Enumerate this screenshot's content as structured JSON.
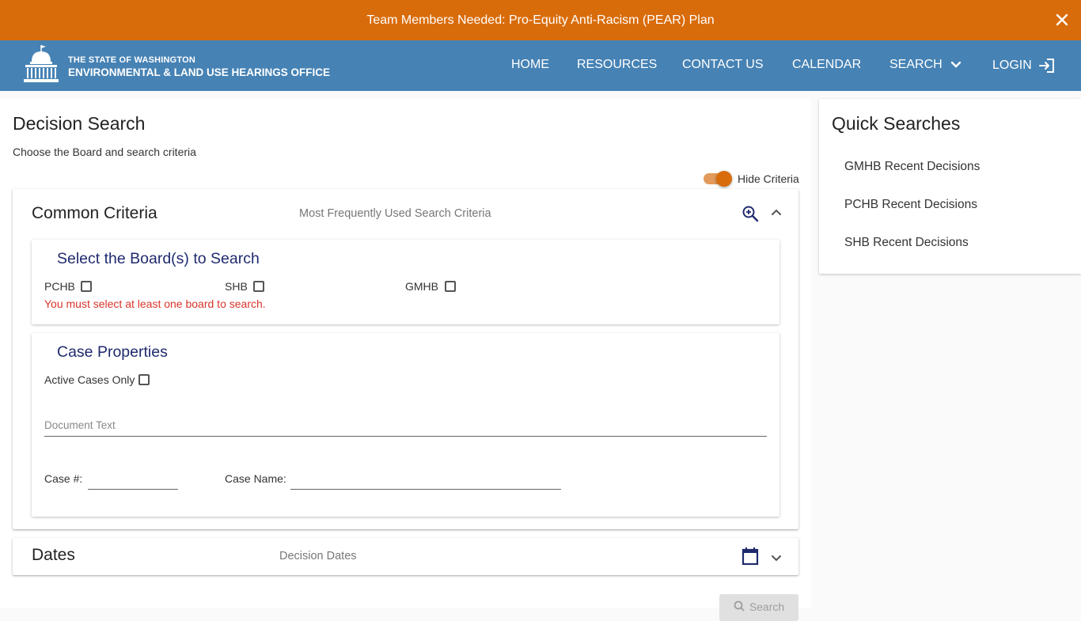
{
  "banner": {
    "text": "Team Members Needed: Pro-Equity Anti-Racism (PEAR) Plan",
    "close_icon": "close-icon"
  },
  "header": {
    "logo_line1": "THE STATE OF WASHINGTON",
    "logo_line2": "ENVIRONMENTAL & LAND USE HEARINGS OFFICE",
    "logo_icon": "capitol-building-icon",
    "nav": {
      "home": "HOME",
      "resources": "RESOURCES",
      "contact": "CONTACT US",
      "calendar": "CALENDAR",
      "search": "SEARCH",
      "login": "LOGIN"
    }
  },
  "page": {
    "title": "Decision Search",
    "subtitle": "Choose the Board and search criteria",
    "toggle_label": "Hide Criteria",
    "toggle_on": true
  },
  "common": {
    "title": "Common Criteria",
    "desc": "Most Frequently Used Search Criteria",
    "boards": {
      "title": "Select the Board(s) to Search",
      "pchb": "PCHB",
      "shb": "SHB",
      "gmhb": "GMHB",
      "error": "You must select at least one board to search."
    },
    "case": {
      "title": "Case Properties",
      "active_only": "Active Cases Only",
      "document_text_placeholder": "Document Text",
      "case_number_label": "Case #:",
      "case_name_label": "Case Name:"
    }
  },
  "dates": {
    "title": "Dates",
    "desc": "Decision Dates"
  },
  "search_button": "Search",
  "quick": {
    "title": "Quick Searches",
    "items": [
      "GMHB Recent Decisions",
      "PCHB Recent Decisions",
      "SHB Recent Decisions"
    ]
  },
  "colors": {
    "banner": "#d96c0a",
    "header": "#4682b4",
    "subtitle_blue": "#1f2a6e",
    "error": "#d9342b"
  }
}
